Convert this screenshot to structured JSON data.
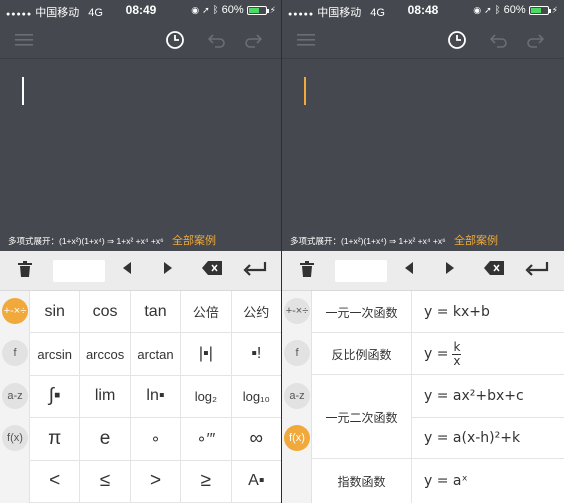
{
  "status_left": {
    "carrier": "中国移动",
    "network": "4G",
    "time": "08:49",
    "battery": "60%"
  },
  "status_right": {
    "carrier": "中国移动",
    "network": "4G",
    "time": "08:48",
    "battery": "60%"
  },
  "hint": {
    "text": "多项式展开：(1+x²)(1+x⁴) ⇒ 1+x² +x⁴ +x⁶",
    "all_examples": "全部案例"
  },
  "colors": {
    "dark_bg": "#45484e",
    "accent": "#f0a93a",
    "cursor": "#f0a93a"
  },
  "categories": [
    "+-×÷",
    "f",
    "a-z",
    "f(x)"
  ],
  "keys": [
    [
      "sin",
      "cos",
      "tan",
      "公倍",
      "公约"
    ],
    [
      "arcsin",
      "arccos",
      "arctan",
      "|▪|",
      "▪!"
    ],
    [
      "∫▪",
      "lim",
      "ln▪",
      "log₂",
      "log₁₀"
    ],
    [
      "π",
      "e",
      "∘",
      "∘′″",
      "∞"
    ],
    [
      "<",
      "≤",
      ">",
      "≥",
      "A▪"
    ]
  ],
  "functions": [
    {
      "category": "一元一次函数",
      "formula": "y = kx+b"
    },
    {
      "category": "反比例函数",
      "formula_prefix": "y =",
      "num": "k",
      "den": "x"
    },
    {
      "category": "一元二次函数",
      "formula": "y = ax²+bx+c"
    },
    {
      "category": "",
      "formula": "y = a(x-h)²+k"
    },
    {
      "category": "指数函数",
      "formula": "y = aˣ"
    }
  ]
}
